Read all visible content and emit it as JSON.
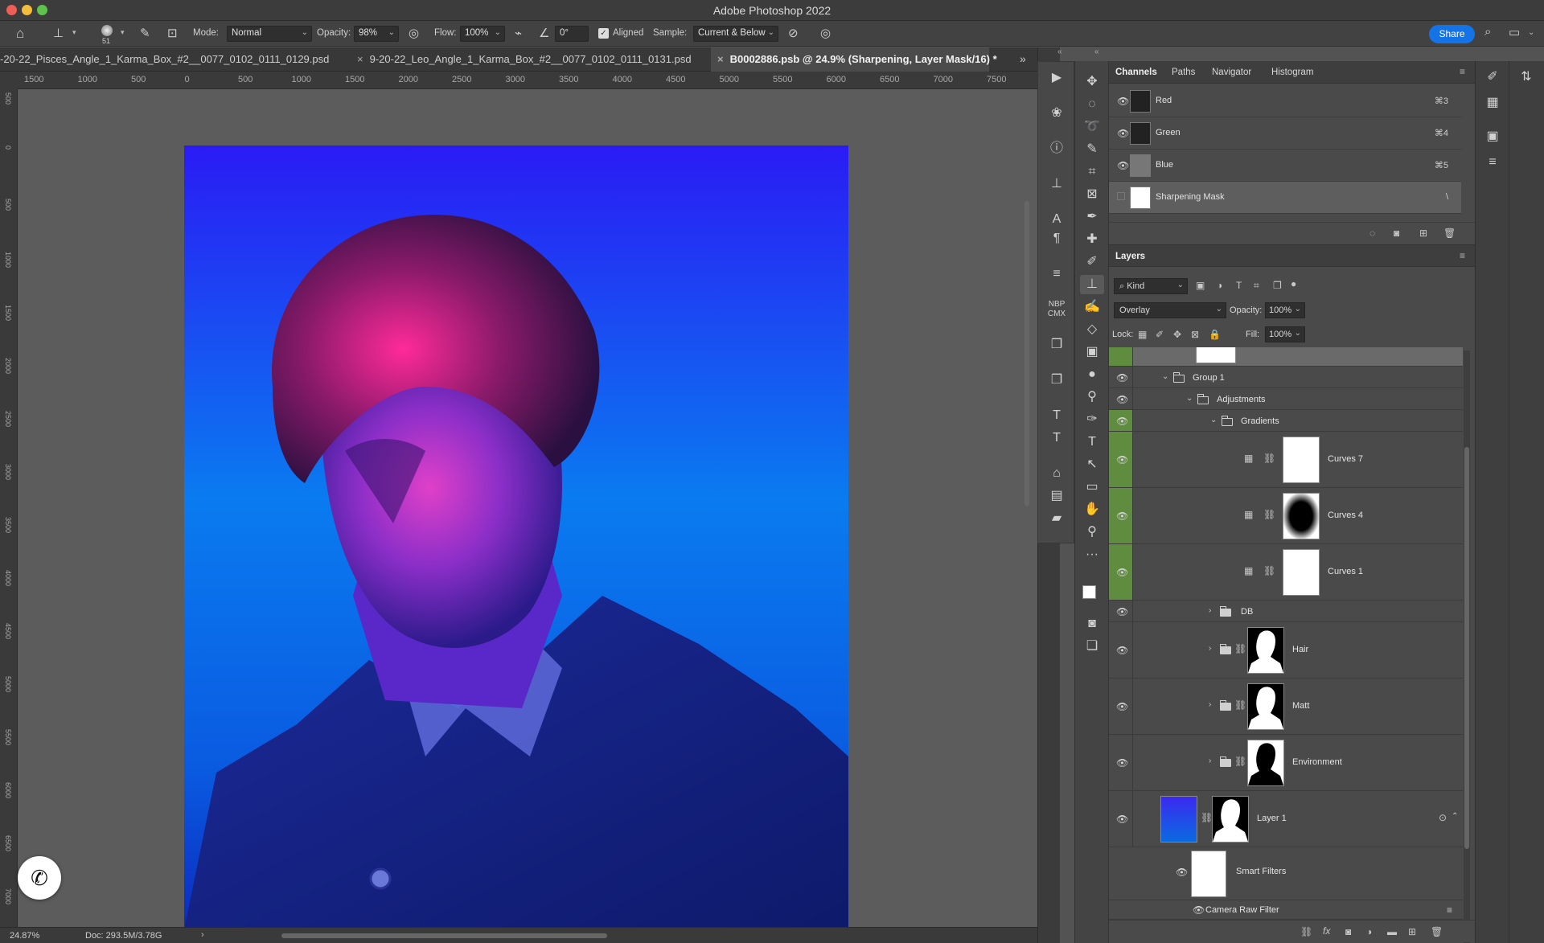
{
  "titlebar": {
    "title": "Adobe Photoshop 2022"
  },
  "options": {
    "brush_size": "51",
    "mode_label": "Mode:",
    "mode_value": "Normal",
    "opacity_label": "Opacity:",
    "opacity_value": "98%",
    "flow_label": "Flow:",
    "flow_value": "100%",
    "angle_value": "0°",
    "aligned_label": "Aligned",
    "sample_label": "Sample:",
    "sample_value": "Current & Below",
    "share_label": "Share"
  },
  "tabs": [
    {
      "label": "-20-22_Pisces_Angle_1_Karma_Box_#2__0077_0102_0111_0129.psd"
    },
    {
      "label": "9-20-22_Leo_Angle_1_Karma_Box_#2__0077_0102_0111_0131.psd"
    },
    {
      "label": "B0002886.psb @ 24.9% (Sharpening, Layer Mask/16) *"
    }
  ],
  "ruler": {
    "h_ticks": [
      "1500",
      "1000",
      "500",
      "0",
      "500",
      "1000",
      "1500",
      "2000",
      "2500",
      "3000",
      "3500",
      "4000",
      "4500",
      "5000",
      "5500",
      "6000",
      "6500",
      "7000",
      "7500"
    ],
    "v_ticks": [
      "500",
      "0",
      "500",
      "1000",
      "1500",
      "2000",
      "2500",
      "3000",
      "3500",
      "4000",
      "4500",
      "5000",
      "5500",
      "6000",
      "6500",
      "7000"
    ]
  },
  "status": {
    "zoom": "24.87%",
    "doc": "Doc: 293.5M/3.78G"
  },
  "channels_panel": {
    "tabs": [
      "Channels",
      "Paths",
      "Navigator",
      "Histogram"
    ],
    "rows": [
      {
        "name": "Red",
        "key": "⌘3"
      },
      {
        "name": "Green",
        "key": "⌘4"
      },
      {
        "name": "Blue",
        "key": "⌘5"
      },
      {
        "name": "Sharpening Mask",
        "key": "\\"
      }
    ]
  },
  "layers_panel": {
    "tab": "Layers",
    "filter_kind": "Kind",
    "blend_mode": "Overlay",
    "opacity_label": "Opacity:",
    "opacity_value": "100%",
    "lock_label": "Lock:",
    "fill_label": "Fill:",
    "fill_value": "100%",
    "layers": {
      "group1": "Group 1",
      "adjustments": "Adjustments",
      "gradients": "Gradients",
      "curves7": "Curves 7",
      "curves4": "Curves 4",
      "curves1": "Curves 1",
      "db": "DB",
      "hair": "Hair",
      "matt": "Matt",
      "environment": "Environment",
      "layer1": "Layer 1",
      "smart_filters": "Smart Filters",
      "camera_raw": "Camera Raw Filter"
    }
  },
  "colors": {
    "accent": "#1473e6",
    "layer_marker_green": "#5f8c3e",
    "photo_bg_top": "#2a1bf5",
    "photo_bg_mid": "#0a7bf0"
  }
}
